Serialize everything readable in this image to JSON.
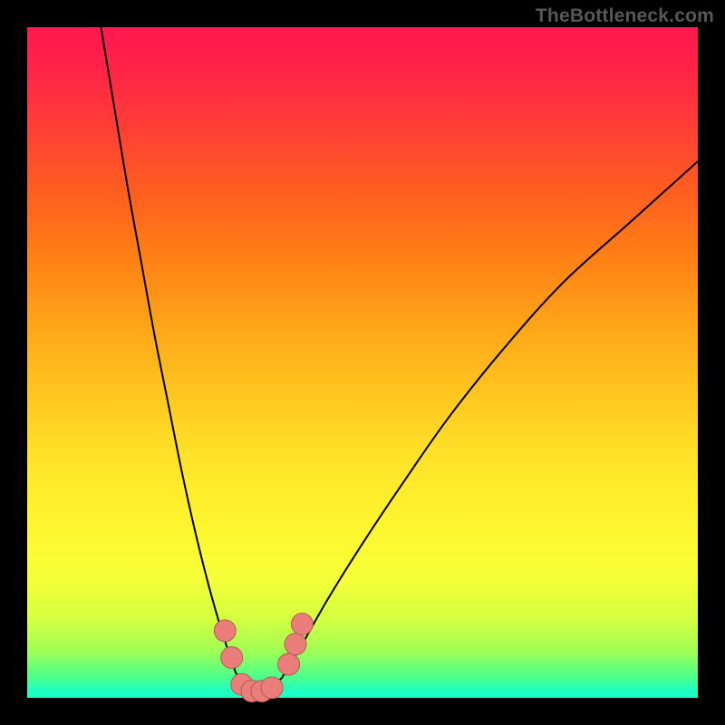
{
  "watermark": "TheBottleneck.com",
  "colors": {
    "background": "#000000",
    "curve_stroke": "#000000",
    "marker_fill": "#eb7e7a",
    "marker_stroke": "#b55a56"
  },
  "chart_data": {
    "type": "line",
    "title": "",
    "xlabel": "",
    "ylabel": "",
    "xlim": [
      0,
      100
    ],
    "ylim": [
      0,
      100
    ],
    "series": [
      {
        "name": "left-branch",
        "x": [
          11,
          13,
          15,
          17,
          19,
          21,
          23,
          25,
          27,
          29,
          31
        ],
        "values": [
          100,
          88,
          76,
          65,
          54,
          44,
          34,
          25,
          17,
          10,
          4
        ]
      },
      {
        "name": "right-branch",
        "x": [
          38,
          41,
          45,
          50,
          56,
          63,
          71,
          80,
          90,
          100
        ],
        "values": [
          3,
          8,
          15,
          23,
          32,
          42,
          52,
          62,
          71,
          80
        ]
      },
      {
        "name": "valley-floor",
        "x": [
          31,
          32,
          33,
          34,
          35,
          36,
          37,
          38
        ],
        "values": [
          4,
          2,
          1,
          0.5,
          0.5,
          1,
          2,
          3
        ]
      }
    ],
    "markers": [
      {
        "x": 29.5,
        "y": 10,
        "r": 1.2
      },
      {
        "x": 30.5,
        "y": 6,
        "r": 1.2
      },
      {
        "x": 32.0,
        "y": 2,
        "r": 1.2
      },
      {
        "x": 33.5,
        "y": 1,
        "r": 1.2
      },
      {
        "x": 35.0,
        "y": 1,
        "r": 1.2
      },
      {
        "x": 36.5,
        "y": 1.5,
        "r": 1.2
      },
      {
        "x": 39.0,
        "y": 5,
        "r": 1.2
      },
      {
        "x": 40.0,
        "y": 8,
        "r": 1.2
      },
      {
        "x": 41.0,
        "y": 11,
        "r": 1.2
      }
    ]
  }
}
